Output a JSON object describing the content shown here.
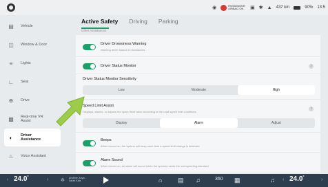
{
  "status": {
    "airbag_text": "PASSENGER AIRBAG ON",
    "range": "437 km",
    "battery": "90%",
    "time": "13:5"
  },
  "sidebar": {
    "items": [
      {
        "label": "Vehicle",
        "icon": "car-icon"
      },
      {
        "label": "Window & Door",
        "icon": "window-icon"
      },
      {
        "label": "Lights",
        "icon": "lights-icon"
      },
      {
        "label": "Seat",
        "icon": "seat-icon"
      },
      {
        "label": "Drive",
        "icon": "steering-icon"
      },
      {
        "label": "Real-time VR Assist",
        "icon": "vr-icon"
      },
      {
        "label": "Driver Assistance",
        "icon": "assistance-icon"
      },
      {
        "label": "Voice Assistant",
        "icon": "voice-icon"
      }
    ],
    "active_index": 6
  },
  "header": {
    "tabs": [
      "Active Safety",
      "Driving",
      "Parking"
    ],
    "active_tab": 0,
    "subtab": "Other Assistances"
  },
  "content": {
    "drowsiness": {
      "title": "Driver Drowsiness Warning",
      "desc": "Warning driver based on drowsiness",
      "enabled": true
    },
    "status_monitor": {
      "title": "Driver Status Monitor",
      "enabled": true
    },
    "sensitivity": {
      "title": "Driver Status Monitor Sensitivity",
      "options": [
        "Low",
        "Moderate",
        "High"
      ],
      "selected": 2
    },
    "speed_limit": {
      "title": "Speed Limit Assist",
      "desc": "Displays, alarms, or adjusts the speed limit value according to the road speed limit conditions.",
      "options": [
        "Display",
        "Alarm",
        "Adjust"
      ],
      "selected": 1
    },
    "beeps": {
      "title": "Beeps",
      "desc": "When turned on, the system will beep each time a speed limit change is detected",
      "enabled": true
    },
    "alarm_sound": {
      "title": "Alarm Sound",
      "desc": "When turned on, an alarm will sound when the speeds meets the overspeeding standard",
      "enabled": true
    }
  },
  "bottom": {
    "left_temp": "24.0",
    "right_temp": "24.0",
    "temp_unit": "°",
    "media_line1": "Anytime, Anyw..",
    "media_line2": "Sarah Kate",
    "accent": "#1e9e6b"
  }
}
